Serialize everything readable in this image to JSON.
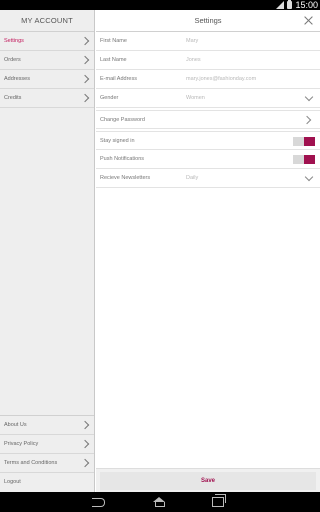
{
  "status_bar": {
    "time": "15:00"
  },
  "sidebar": {
    "title": "MY ACCOUNT",
    "items": [
      {
        "label": "Settings",
        "active": true
      },
      {
        "label": "Orders"
      },
      {
        "label": "Addresses"
      },
      {
        "label": "Credits"
      }
    ],
    "bottom_items": [
      {
        "label": "About Us"
      },
      {
        "label": "Privacy Policy"
      },
      {
        "label": "Terms and Conditions"
      },
      {
        "label": "Logout"
      }
    ]
  },
  "settings": {
    "title": "Settings",
    "fields": [
      {
        "label": "First Name",
        "value": "Mary"
      },
      {
        "label": "Last Name",
        "value": "Jones"
      },
      {
        "label": "E-mail Address",
        "value": "mary.jones@fashionday.com"
      },
      {
        "label": "Gender",
        "value": "Women"
      }
    ],
    "change_password_label": "Change Password",
    "stay_signed_in_label": "Stay signed in",
    "push_notifications_label": "Push Notifications",
    "newsletters": {
      "label": "Recieve Newsletters",
      "value": "Daily"
    },
    "save_label": "Save"
  },
  "colors": {
    "accent": "#a0114f",
    "active_nav": "#c2185b"
  }
}
